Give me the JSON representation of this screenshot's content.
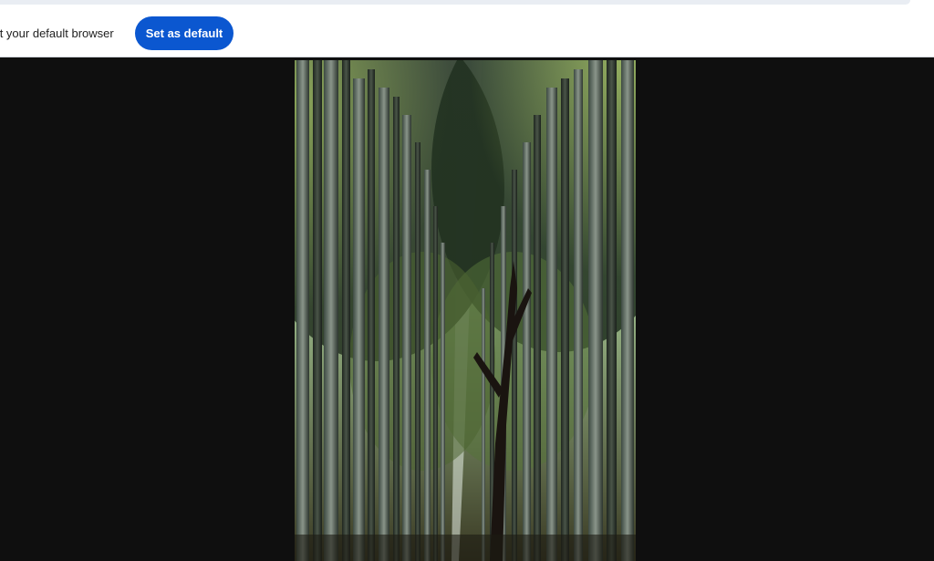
{
  "infobar": {
    "message": "n't your default browser",
    "button_label": "Set as default"
  },
  "viewer": {
    "image_alt": "bamboo-forest-photo"
  },
  "colors": {
    "accent": "#0b57d0",
    "viewer_bg": "#0f0f0f",
    "infobar_bg": "#ffffff"
  }
}
